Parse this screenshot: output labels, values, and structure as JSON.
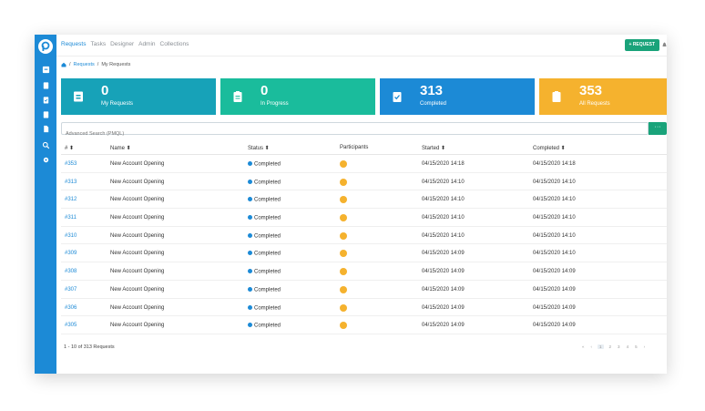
{
  "nav": {
    "items": [
      "Requests",
      "Tasks",
      "Designer",
      "Admin",
      "Collections"
    ],
    "active": "Requests"
  },
  "header": {
    "request_button": "+ REQUEST"
  },
  "breadcrumb": {
    "home_icon": "home-icon",
    "sep": "/",
    "link": "Requests",
    "current": "My Requests"
  },
  "cards": [
    {
      "count": "0",
      "label": "My Requests",
      "color": "#17a2b8",
      "icon": "inbox-icon"
    },
    {
      "count": "0",
      "label": "In Progress",
      "color": "#1abc9c",
      "icon": "clipboard-icon"
    },
    {
      "count": "313",
      "label": "Completed",
      "color": "#1c8ad6",
      "icon": "clipboard-check-icon"
    },
    {
      "count": "353",
      "label": "All Requests",
      "color": "#f5b22e",
      "icon": "clipboard-icon"
    }
  ],
  "search": {
    "placeholder": "Advanced Search (PMQL)",
    "button": "···"
  },
  "table": {
    "headers": [
      "# ⬍",
      "Name ⬍",
      "Status ⬍",
      "Participants",
      "Started ⬍",
      "Completed ⬍"
    ],
    "rows": [
      {
        "id": "#353",
        "name": "New Account Opening",
        "status": "Completed",
        "started": "04/15/2020 14:18",
        "completed": "04/15/2020 14:18"
      },
      {
        "id": "#313",
        "name": "New Account Opening",
        "status": "Completed",
        "started": "04/15/2020 14:10",
        "completed": "04/15/2020 14:10"
      },
      {
        "id": "#312",
        "name": "New Account Opening",
        "status": "Completed",
        "started": "04/15/2020 14:10",
        "completed": "04/15/2020 14:10"
      },
      {
        "id": "#311",
        "name": "New Account Opening",
        "status": "Completed",
        "started": "04/15/2020 14:10",
        "completed": "04/15/2020 14:10"
      },
      {
        "id": "#310",
        "name": "New Account Opening",
        "status": "Completed",
        "started": "04/15/2020 14:10",
        "completed": "04/15/2020 14:10"
      },
      {
        "id": "#309",
        "name": "New Account Opening",
        "status": "Completed",
        "started": "04/15/2020 14:09",
        "completed": "04/15/2020 14:10"
      },
      {
        "id": "#308",
        "name": "New Account Opening",
        "status": "Completed",
        "started": "04/15/2020 14:09",
        "completed": "04/15/2020 14:09"
      },
      {
        "id": "#307",
        "name": "New Account Opening",
        "status": "Completed",
        "started": "04/15/2020 14:09",
        "completed": "04/15/2020 14:09"
      },
      {
        "id": "#306",
        "name": "New Account Opening",
        "status": "Completed",
        "started": "04/15/2020 14:09",
        "completed": "04/15/2020 14:09"
      },
      {
        "id": "#305",
        "name": "New Account Opening",
        "status": "Completed",
        "started": "04/15/2020 14:09",
        "completed": "04/15/2020 14:09"
      }
    ]
  },
  "footer": {
    "summary": "1 - 10 of 313 Requests"
  },
  "pager": [
    "«",
    "‹",
    "1",
    "2",
    "3",
    "4",
    "5",
    "›"
  ],
  "colors": {
    "sidebar": "#1c8ad6",
    "accent_green": "#1aa37a",
    "participant": "#f5b22e"
  }
}
